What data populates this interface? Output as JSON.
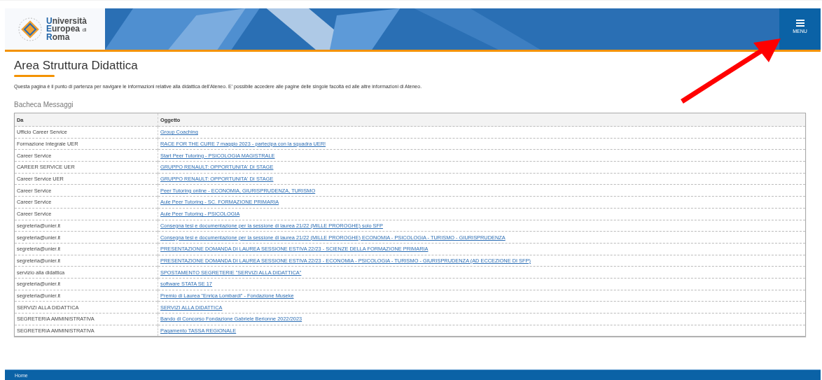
{
  "header": {
    "logo": {
      "line_1": "Università",
      "line_2": "Europea",
      "line_2_suffix": "di",
      "line_3": "Roma"
    },
    "menu_button": {
      "label": "MENU"
    }
  },
  "page": {
    "title": "Area Struttura Didattica",
    "intro": "Questa pagina è il punto di partenza per navigare le informazioni relative alla didattica dell'Ateneo. E' possibile accedere alle pagine delle singole facoltà ed alle altre informazioni di Ateneo."
  },
  "board": {
    "title": "Bacheca Messaggi",
    "columns": [
      "Da",
      "Oggetto"
    ],
    "rows": [
      {
        "from": "Ufficio Career Service",
        "subject": "Group Coaching"
      },
      {
        "from": "Formazione Integrale UER",
        "subject": "RACE FOR THE CURE 7 maggio 2023 - partecipa con la squadra UER!"
      },
      {
        "from": "Career Service",
        "subject": "Start Peer Tutoring - PSICOLOGIA MAGISTRALE"
      },
      {
        "from": "CAREER SERVICE UER",
        "subject": "GRUPPO RENAULT: OPPORTUNITA' DI STAGE"
      },
      {
        "from": "Career Service UER",
        "subject": "GRUPPO RENAULT: OPPORTUNITA' DI STAGE"
      },
      {
        "from": "Career Service",
        "subject": "Peer Tutoring online - ECONOMIA, GIURISPRUDENZA, TURISMO"
      },
      {
        "from": "Career Service",
        "subject": "Aule Peer Tutoring - SC. FORMAZIONE PRIMARIA"
      },
      {
        "from": "Career Service",
        "subject": "Aule Peer Tutoring - PSICOLOGIA"
      },
      {
        "from": "segreteria@unier.it",
        "subject": "Consegna tesi e documentazione per la sessione di laurea 21/22 (MILLE PROROGHE) solo SFP"
      },
      {
        "from": "segreteria@unier.it",
        "subject": "Consegna tesi e documentazione per la sessione di laurea 21/22 (MILLE PROROGHE) ECONOMIA - PSICOLOGIA - TURISMO - GIURISPRUDENZA"
      },
      {
        "from": "segreteria@unier.it",
        "subject": "PRESENTAZIONE DOMANDA DI LAUREA SESSIONE ESTIVA 22/23 - SCIENZE DELLA FORMAZIONE PRIMARIA"
      },
      {
        "from": "segreteria@unier.it",
        "subject": "PRESENTAZIONE DOMANDA DI LAUREA SESSIONE ESTIVA 22/23 - ECONOMIA - PSICOLOGIA - TURISMO - GIURISPRUDENZA (AD ECCEZIONE DI SFP)"
      },
      {
        "from": "servizio alla didattica",
        "subject": "SPOSTAMENTO SEGRETERIE \"SERVIZI ALLA DIDATTICA\""
      },
      {
        "from": "segreteria@unier.it",
        "subject": "software STATA SE 17"
      },
      {
        "from": "segreteria@unier.it",
        "subject": "Premio di Laurea \"Enrica Lombardi\" - Fondazione Museke"
      },
      {
        "from": "SERVIZI ALLA DIDATTICA",
        "subject": "SERVIZI ALLA DIDATTICA"
      },
      {
        "from": "SEGRETERIA AMMINISTRATIVA",
        "subject": "Bando di Concorso Fondazione Gabriele Berionne 2022/2023"
      },
      {
        "from": "SEGRETERIA AMMINISTRATIVA",
        "subject": "Pagamento TASSA REGIONALE"
      }
    ]
  },
  "footer": {
    "link": "Home"
  }
}
